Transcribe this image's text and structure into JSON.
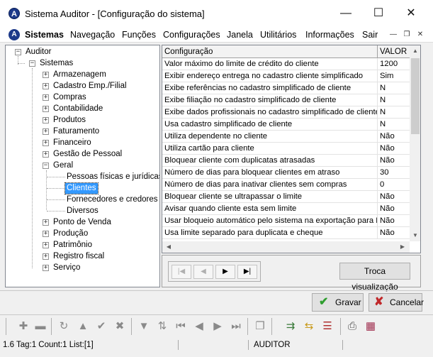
{
  "window": {
    "title": "Sistema Auditor - [Configuração do sistema]",
    "minimize": "—",
    "maximize": "☐",
    "close": "✕"
  },
  "menu": {
    "app_letter": "A",
    "items": [
      "Sistemas",
      "Navegação",
      "Funções",
      "Configurações",
      "Janela",
      "Utilitários",
      "Informações",
      "Sair"
    ],
    "mdi_buttons": [
      "—",
      "❐",
      "✕"
    ]
  },
  "tree": {
    "root": "Auditor",
    "group": "Sistemas",
    "modules_top": [
      "Armazenagem",
      "Cadastro Emp./Filial",
      "Compras",
      "Contabilidade",
      "Produtos",
      "Faturamento",
      "Financeiro",
      "Gestão de Pessoal"
    ],
    "geral": "Geral",
    "geral_children": [
      "Pessoas físicas e jurídicas",
      "Clientes",
      "Fornecedores e credores",
      "Diversos"
    ],
    "selected": "Clientes",
    "modules_bottom": [
      "Ponto de Venda",
      "Produção",
      "Patrimônio",
      "Registro fiscal",
      "Serviço"
    ]
  },
  "grid": {
    "headers": [
      "Configuração",
      "VALOR"
    ],
    "rows": [
      [
        "Valor máximo do limite de crédito do cliente",
        "1200"
      ],
      [
        "Exibir endereço entrega no cadastro cliente simplificado",
        "Sim"
      ],
      [
        "Exibe referências no cadastro simplificado de cliente",
        "N"
      ],
      [
        "Exibe filiação no cadastro simplificado de cliente",
        "N"
      ],
      [
        "Exibe dados profissionais no cadastro simplificado de cliente",
        "N"
      ],
      [
        "Usa cadastro simplificado de cliente",
        "N"
      ],
      [
        "Utiliza dependente no cliente",
        "Não"
      ],
      [
        "Utiliza cartão para cliente",
        "Não"
      ],
      [
        "Bloquear cliente com duplicatas atrasadas",
        "Não"
      ],
      [
        "Número de dias para bloquear clientes em atraso",
        "30"
      ],
      [
        "Número de dias para inativar clientes sem compras",
        "0"
      ],
      [
        "Bloquear cliente se ultrapassar o limite",
        "Não"
      ],
      [
        "Avisar quando cliente esta sem limite",
        "Não"
      ],
      [
        "Usar bloqueio automático pelo sistema na exportação para PDV",
        "Não"
      ],
      [
        "Usa limite separado para duplicata e cheque",
        "Não"
      ]
    ]
  },
  "nav": {
    "buttons": [
      "|◀",
      "◀",
      "▶",
      "▶|"
    ],
    "toggle_view": "Troca visualização"
  },
  "actions": {
    "save": "Gravar",
    "save_icon": "✔",
    "cancel": "Cancelar",
    "cancel_icon": "✘"
  },
  "toolbar_icons": [
    "add-icon",
    "remove-icon",
    "refresh-icon",
    "up-icon",
    "confirm-icon",
    "cancel-icon",
    "filter-icon",
    "sort-icon",
    "first-icon",
    "prev-icon",
    "next-icon",
    "last-icon",
    "copy-icon",
    "export-icon",
    "import-icon",
    "report-icon",
    "print-icon",
    "calendar-icon"
  ],
  "status": {
    "info": "1.6 Tag:1 Count:1 List:[1]",
    "user": "AUDITOR"
  },
  "colors": {
    "selection": "#3399ff",
    "save_check": "#2f9e2f",
    "cancel_x": "#c0282a"
  }
}
